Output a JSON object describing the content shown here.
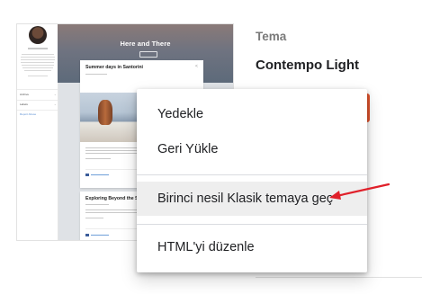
{
  "theme_preview": {
    "blog_title": "Here and There",
    "sidebar_labels": [
      "Archive",
      "Labels",
      "Report Abuse"
    ],
    "post_1_title": "Summer days in Santorini",
    "post_2_title": "Exploring Beyond the Sky"
  },
  "panel": {
    "section_label": "Tema",
    "current_theme": "Contempo Light"
  },
  "menu": {
    "items": [
      {
        "label": "Yedekle"
      },
      {
        "label": "Geri Yükle"
      },
      {
        "label": "Birinci nesil Klasik temaya geç"
      },
      {
        "label": "HTML'yi düzenle"
      }
    ]
  },
  "colors": {
    "accent": "#e2542d",
    "annotation_arrow": "#e0202a",
    "highlight_row": "#eeeeee"
  }
}
